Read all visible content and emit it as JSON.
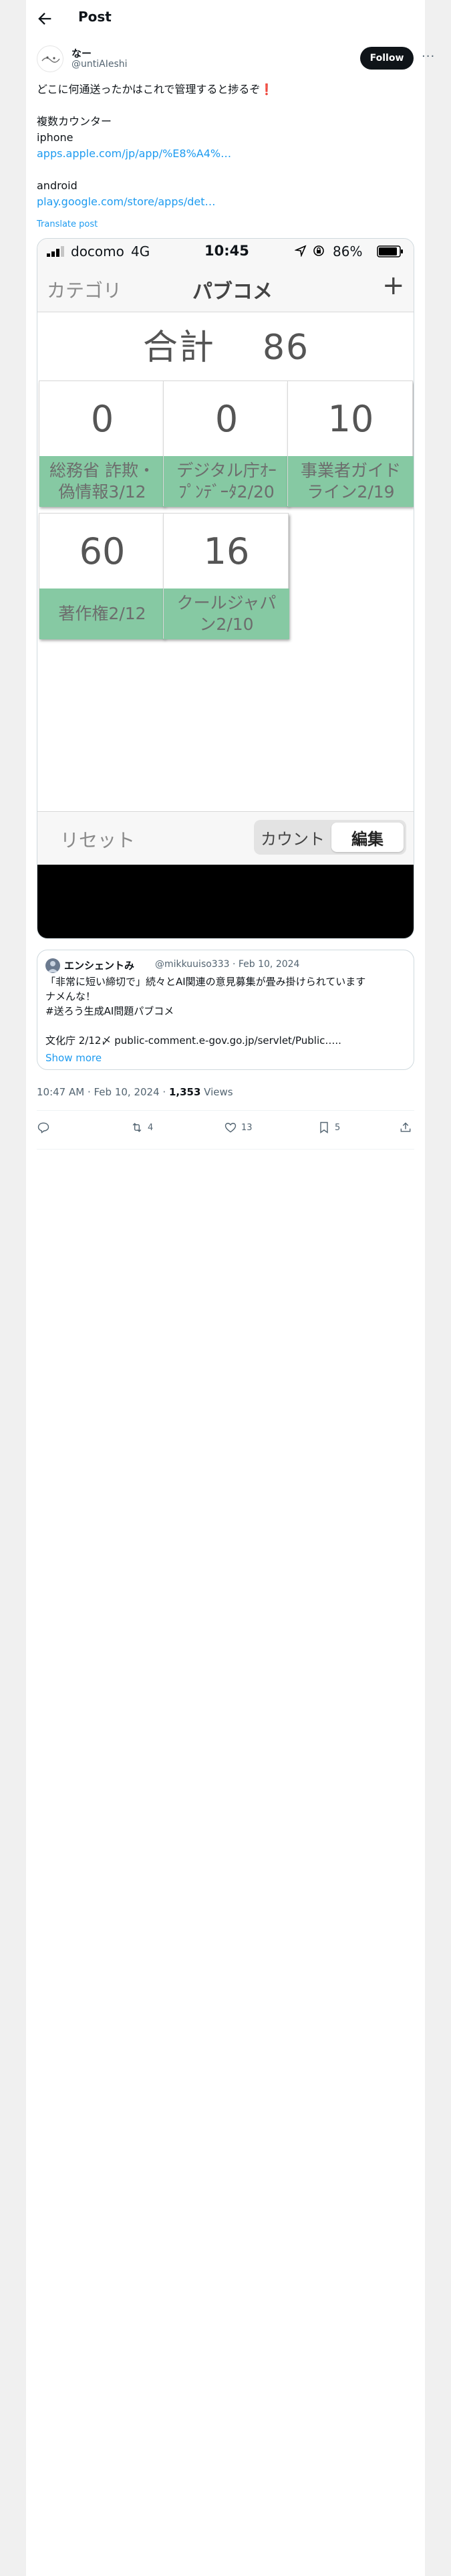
{
  "header": {
    "title": "Post"
  },
  "author": {
    "display_name": "なー",
    "handle": "@untiAIeshi",
    "follow_label": "Follow",
    "more_label": "···"
  },
  "tweet": {
    "lines": [
      "どこに何通送ったかはこれで管理すると捗るぞ❗",
      "",
      "複数カウンター",
      "iphone",
      "apps.apple.com/jp/app/%E8%A4%…",
      "",
      "android",
      "play.google.com/store/apps/det…"
    ],
    "translate_label": "Translate post"
  },
  "screenshot": {
    "status_bar": {
      "carrier": "docomo",
      "network": "4G",
      "time": "10:45",
      "battery": "86%"
    },
    "navbar": {
      "left": "カテゴリ",
      "title": "パブコメ",
      "plus": "+"
    },
    "total_label": "合計",
    "total_value": "86",
    "cells": [
      {
        "value": "0",
        "label_lines": [
          "総務省 詐欺・",
          "偽情報3/12"
        ]
      },
      {
        "value": "0",
        "label_lines": [
          "デジタル庁ｵｰ",
          "ﾌﾟﾝﾃﾞｰﾀ2/20"
        ]
      },
      {
        "value": "10",
        "label_lines": [
          "事業者ガイド",
          "ライン2/19"
        ]
      },
      {
        "value": "60",
        "label_lines": [
          "著作権2/12"
        ]
      },
      {
        "value": "16",
        "label_lines": [
          "クールジャパ",
          "ン2/10"
        ]
      }
    ],
    "bottom": {
      "reset": "リセット",
      "count": "カウント",
      "edit": "編集"
    }
  },
  "quote": {
    "name": "エンシェントみ",
    "meta": "@mikkuuiso333 · Feb 10, 2024",
    "lines": [
      "「非常に短い締切で」続々とAI関連の意見募集が畳み掛けられています",
      "ナメんな！",
      "#送ろう生成AI問題パブコメ",
      "",
      "文化庁 2/12〆 public-comment.e-gov.go.jp/servlet/Public….."
    ],
    "show_more": "Show more"
  },
  "meta": {
    "time_date": "10:47 AM · Feb 10, 2024 · ",
    "views_count": "1,353",
    "views_label": " Views"
  },
  "actions": {
    "reply": "",
    "retweets": "4",
    "likes": "13",
    "bookmarks": "5"
  }
}
